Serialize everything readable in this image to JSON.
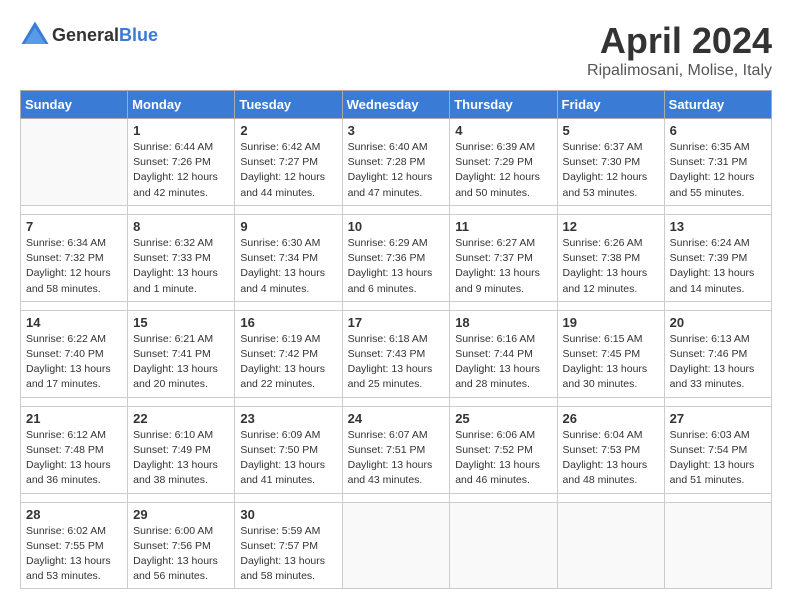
{
  "header": {
    "logo_general": "General",
    "logo_blue": "Blue",
    "title": "April 2024",
    "subtitle": "Ripalimosani, Molise, Italy"
  },
  "calendar": {
    "headers": [
      "Sunday",
      "Monday",
      "Tuesday",
      "Wednesday",
      "Thursday",
      "Friday",
      "Saturday"
    ],
    "weeks": [
      [
        {
          "num": "",
          "info": ""
        },
        {
          "num": "1",
          "info": "Sunrise: 6:44 AM\nSunset: 7:26 PM\nDaylight: 12 hours\nand 42 minutes."
        },
        {
          "num": "2",
          "info": "Sunrise: 6:42 AM\nSunset: 7:27 PM\nDaylight: 12 hours\nand 44 minutes."
        },
        {
          "num": "3",
          "info": "Sunrise: 6:40 AM\nSunset: 7:28 PM\nDaylight: 12 hours\nand 47 minutes."
        },
        {
          "num": "4",
          "info": "Sunrise: 6:39 AM\nSunset: 7:29 PM\nDaylight: 12 hours\nand 50 minutes."
        },
        {
          "num": "5",
          "info": "Sunrise: 6:37 AM\nSunset: 7:30 PM\nDaylight: 12 hours\nand 53 minutes."
        },
        {
          "num": "6",
          "info": "Sunrise: 6:35 AM\nSunset: 7:31 PM\nDaylight: 12 hours\nand 55 minutes."
        }
      ],
      [
        {
          "num": "7",
          "info": "Sunrise: 6:34 AM\nSunset: 7:32 PM\nDaylight: 12 hours\nand 58 minutes."
        },
        {
          "num": "8",
          "info": "Sunrise: 6:32 AM\nSunset: 7:33 PM\nDaylight: 13 hours\nand 1 minute."
        },
        {
          "num": "9",
          "info": "Sunrise: 6:30 AM\nSunset: 7:34 PM\nDaylight: 13 hours\nand 4 minutes."
        },
        {
          "num": "10",
          "info": "Sunrise: 6:29 AM\nSunset: 7:36 PM\nDaylight: 13 hours\nand 6 minutes."
        },
        {
          "num": "11",
          "info": "Sunrise: 6:27 AM\nSunset: 7:37 PM\nDaylight: 13 hours\nand 9 minutes."
        },
        {
          "num": "12",
          "info": "Sunrise: 6:26 AM\nSunset: 7:38 PM\nDaylight: 13 hours\nand 12 minutes."
        },
        {
          "num": "13",
          "info": "Sunrise: 6:24 AM\nSunset: 7:39 PM\nDaylight: 13 hours\nand 14 minutes."
        }
      ],
      [
        {
          "num": "14",
          "info": "Sunrise: 6:22 AM\nSunset: 7:40 PM\nDaylight: 13 hours\nand 17 minutes."
        },
        {
          "num": "15",
          "info": "Sunrise: 6:21 AM\nSunset: 7:41 PM\nDaylight: 13 hours\nand 20 minutes."
        },
        {
          "num": "16",
          "info": "Sunrise: 6:19 AM\nSunset: 7:42 PM\nDaylight: 13 hours\nand 22 minutes."
        },
        {
          "num": "17",
          "info": "Sunrise: 6:18 AM\nSunset: 7:43 PM\nDaylight: 13 hours\nand 25 minutes."
        },
        {
          "num": "18",
          "info": "Sunrise: 6:16 AM\nSunset: 7:44 PM\nDaylight: 13 hours\nand 28 minutes."
        },
        {
          "num": "19",
          "info": "Sunrise: 6:15 AM\nSunset: 7:45 PM\nDaylight: 13 hours\nand 30 minutes."
        },
        {
          "num": "20",
          "info": "Sunrise: 6:13 AM\nSunset: 7:46 PM\nDaylight: 13 hours\nand 33 minutes."
        }
      ],
      [
        {
          "num": "21",
          "info": "Sunrise: 6:12 AM\nSunset: 7:48 PM\nDaylight: 13 hours\nand 36 minutes."
        },
        {
          "num": "22",
          "info": "Sunrise: 6:10 AM\nSunset: 7:49 PM\nDaylight: 13 hours\nand 38 minutes."
        },
        {
          "num": "23",
          "info": "Sunrise: 6:09 AM\nSunset: 7:50 PM\nDaylight: 13 hours\nand 41 minutes."
        },
        {
          "num": "24",
          "info": "Sunrise: 6:07 AM\nSunset: 7:51 PM\nDaylight: 13 hours\nand 43 minutes."
        },
        {
          "num": "25",
          "info": "Sunrise: 6:06 AM\nSunset: 7:52 PM\nDaylight: 13 hours\nand 46 minutes."
        },
        {
          "num": "26",
          "info": "Sunrise: 6:04 AM\nSunset: 7:53 PM\nDaylight: 13 hours\nand 48 minutes."
        },
        {
          "num": "27",
          "info": "Sunrise: 6:03 AM\nSunset: 7:54 PM\nDaylight: 13 hours\nand 51 minutes."
        }
      ],
      [
        {
          "num": "28",
          "info": "Sunrise: 6:02 AM\nSunset: 7:55 PM\nDaylight: 13 hours\nand 53 minutes."
        },
        {
          "num": "29",
          "info": "Sunrise: 6:00 AM\nSunset: 7:56 PM\nDaylight: 13 hours\nand 56 minutes."
        },
        {
          "num": "30",
          "info": "Sunrise: 5:59 AM\nSunset: 7:57 PM\nDaylight: 13 hours\nand 58 minutes."
        },
        {
          "num": "",
          "info": ""
        },
        {
          "num": "",
          "info": ""
        },
        {
          "num": "",
          "info": ""
        },
        {
          "num": "",
          "info": ""
        }
      ]
    ]
  }
}
